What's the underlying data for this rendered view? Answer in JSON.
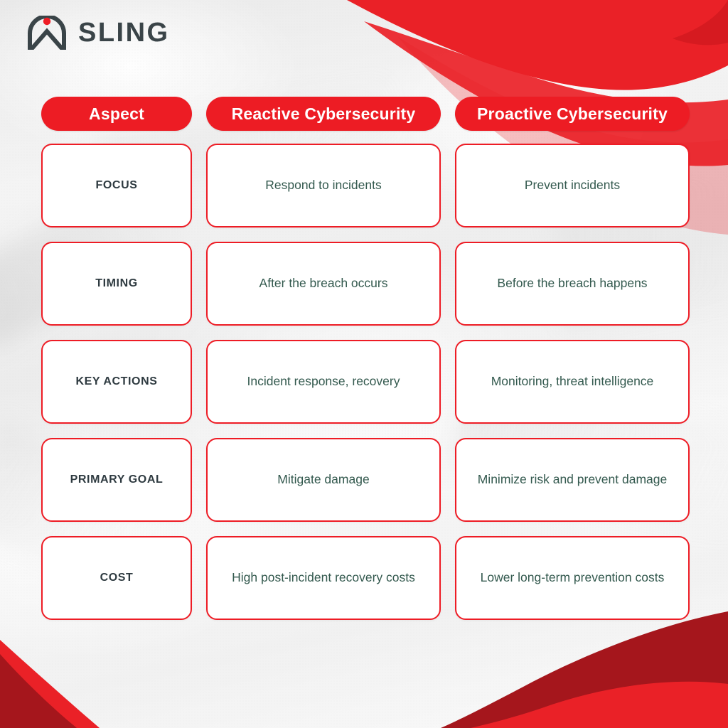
{
  "brand": {
    "name": "SLING",
    "mark_icon": "sling-arch-logo-icon",
    "logo_dot_color": "#ee1c24",
    "wordmark_color": "#3a4448"
  },
  "theme": {
    "accent_red": "#ed1c24",
    "accent_dark_red": "#a5161c",
    "body_text_color": "#33594e",
    "aspect_text_color": "#2e3a40",
    "card_bg": "#ffffff",
    "page_bg": "#f1f1f1"
  },
  "table": {
    "headers": [
      {
        "label": "Aspect"
      },
      {
        "label": "Reactive Cybersecurity"
      },
      {
        "label": "Proactive Cybersecurity"
      }
    ],
    "rows": [
      {
        "aspect": "FOCUS",
        "reactive": "Respond to incidents",
        "proactive": "Prevent incidents"
      },
      {
        "aspect": "TIMING",
        "reactive": "After the breach occurs",
        "proactive": "Before the breach happens"
      },
      {
        "aspect": "KEY ACTIONS",
        "reactive": "Incident response, recovery",
        "proactive": "Monitoring, threat intelligence"
      },
      {
        "aspect": "PRIMARY GOAL",
        "reactive": "Mitigate damage",
        "proactive": "Minimize risk and prevent damage"
      },
      {
        "aspect": "COST",
        "reactive": "High post-incident recovery costs",
        "proactive": "Lower long-term prevention costs"
      }
    ]
  }
}
